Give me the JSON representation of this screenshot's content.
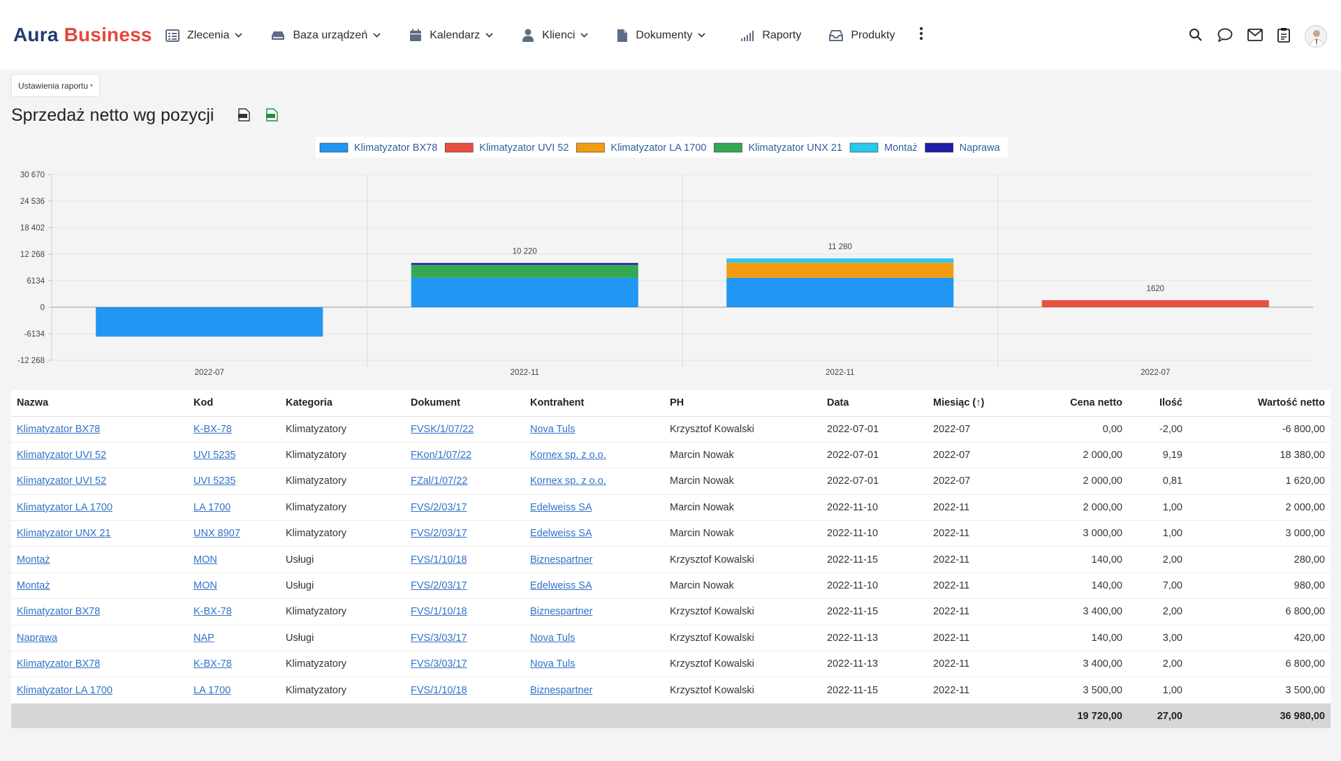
{
  "app": {
    "logo_part1": "Aura",
    "logo_part2": "Business"
  },
  "nav": {
    "items": [
      {
        "label": "Zlecenia",
        "icon": "list-icon",
        "dropdown": true
      },
      {
        "label": "Baza urządzeń",
        "icon": "device-icon",
        "dropdown": true
      },
      {
        "label": "Kalendarz",
        "icon": "calendar-icon",
        "dropdown": true
      },
      {
        "label": "Klienci",
        "icon": "user-icon",
        "dropdown": true
      },
      {
        "label": "Dokumenty",
        "icon": "document-icon",
        "dropdown": true
      },
      {
        "label": "Raporty",
        "icon": "signal-icon",
        "dropdown": false
      },
      {
        "label": "Produkty",
        "icon": "inbox-icon",
        "dropdown": false
      }
    ],
    "right_icons": [
      "search-icon",
      "chat-icon",
      "mail-icon",
      "clipboard-icon",
      "avatar"
    ]
  },
  "settings_label": "Ustawienia raportu",
  "report_title": "Sprzedaż netto wg pozycji",
  "colors": {
    "accent": "#2f73c9",
    "brand_dark": "#1f3c73",
    "brand_red": "#e4473b"
  },
  "chart_data": {
    "type": "bar",
    "stacked": true,
    "categories": [
      "2022-07",
      "2022-11",
      "2022-11",
      "2022-07"
    ],
    "y_ticks": [
      "30 670",
      "24 536",
      "18 402",
      "12 268",
      "6134",
      "0",
      "-6134",
      "-12 268"
    ],
    "ylim": [
      -12268,
      30670
    ],
    "grid": true,
    "legend_position": "top-center",
    "series": [
      {
        "name": "Klimatyzator BX78",
        "color": "#2196f3",
        "values": [
          -6800,
          6800,
          6800,
          0
        ]
      },
      {
        "name": "Klimatyzator UVI 52",
        "color": "#e8503f",
        "values": [
          0,
          0,
          0,
          1620
        ]
      },
      {
        "name": "Klimatyzator LA 1700",
        "color": "#f39c12",
        "values": [
          0,
          0,
          3500,
          0
        ]
      },
      {
        "name": "Klimatyzator UNX 21",
        "color": "#34a853",
        "values": [
          0,
          3000,
          0,
          0
        ]
      },
      {
        "name": "Montaż",
        "color": "#2bc7ef",
        "values": [
          0,
          0,
          980,
          0
        ]
      },
      {
        "name": "Naprawa",
        "color": "#1e1ea8",
        "values": [
          0,
          420,
          0,
          0
        ]
      }
    ],
    "totals_labels": [
      "",
      "10 220",
      "11 280",
      "1620"
    ]
  },
  "table": {
    "headers": [
      "Nazwa",
      "Kod",
      "Kategoria",
      "Dokument",
      "Kontrahent",
      "PH",
      "Data",
      "Miesiąc (↑)",
      "Cena netto",
      "Ilość",
      "Wartość netto"
    ],
    "rows": [
      [
        "Klimatyzator BX78",
        "K-BX-78",
        "Klimatyzatory",
        "FVSK/1/07/22",
        "Nova Tuls",
        "Krzysztof Kowalski",
        "2022-07-01",
        "2022-07",
        "0,00",
        "-2,00",
        "-6 800,00"
      ],
      [
        "Klimatyzator UVI 52",
        "UVI 5235",
        "Klimatyzatory",
        "FKon/1/07/22",
        "Kornex sp. z o.o.",
        "Marcin Nowak",
        "2022-07-01",
        "2022-07",
        "2 000,00",
        "9,19",
        "18 380,00"
      ],
      [
        "Klimatyzator UVI 52",
        "UVI 5235",
        "Klimatyzatory",
        "FZal/1/07/22",
        "Kornex sp. z o.o.",
        "Marcin Nowak",
        "2022-07-01",
        "2022-07",
        "2 000,00",
        "0,81",
        "1 620,00"
      ],
      [
        "Klimatyzator LA 1700",
        "LA 1700",
        "Klimatyzatory",
        "FVS/2/03/17",
        "Edelweiss SA",
        "Marcin Nowak",
        "2022-11-10",
        "2022-11",
        "2 000,00",
        "1,00",
        "2 000,00"
      ],
      [
        "Klimatyzator UNX 21",
        "UNX 8907",
        "Klimatyzatory",
        "FVS/2/03/17",
        "Edelweiss SA",
        "Marcin Nowak",
        "2022-11-10",
        "2022-11",
        "3 000,00",
        "1,00",
        "3 000,00"
      ],
      [
        "Montaż",
        "MON",
        "Usługi",
        "FVS/1/10/18",
        "Biznespartner",
        "Krzysztof Kowalski",
        "2022-11-15",
        "2022-11",
        "140,00",
        "2,00",
        "280,00"
      ],
      [
        "Montaż",
        "MON",
        "Usługi",
        "FVS/2/03/17",
        "Edelweiss SA",
        "Marcin Nowak",
        "2022-11-10",
        "2022-11",
        "140,00",
        "7,00",
        "980,00"
      ],
      [
        "Klimatyzator BX78",
        "K-BX-78",
        "Klimatyzatory",
        "FVS/1/10/18",
        "Biznespartner",
        "Krzysztof Kowalski",
        "2022-11-15",
        "2022-11",
        "3 400,00",
        "2,00",
        "6 800,00"
      ],
      [
        "Naprawa",
        "NAP",
        "Usługi",
        "FVS/3/03/17",
        "Nova Tuls",
        "Krzysztof Kowalski",
        "2022-11-13",
        "2022-11",
        "140,00",
        "3,00",
        "420,00"
      ],
      [
        "Klimatyzator BX78",
        "K-BX-78",
        "Klimatyzatory",
        "FVS/3/03/17",
        "Nova Tuls",
        "Krzysztof Kowalski",
        "2022-11-13",
        "2022-11",
        "3 400,00",
        "2,00",
        "6 800,00"
      ],
      [
        "Klimatyzator LA 1700",
        "LA 1700",
        "Klimatyzatory",
        "FVS/1/10/18",
        "Biznespartner",
        "Krzysztof Kowalski",
        "2022-11-15",
        "2022-11",
        "3 500,00",
        "1,00",
        "3 500,00"
      ]
    ],
    "totals": {
      "cena": "19 720,00",
      "ilosc": "27,00",
      "wartosc": "36 980,00"
    }
  }
}
